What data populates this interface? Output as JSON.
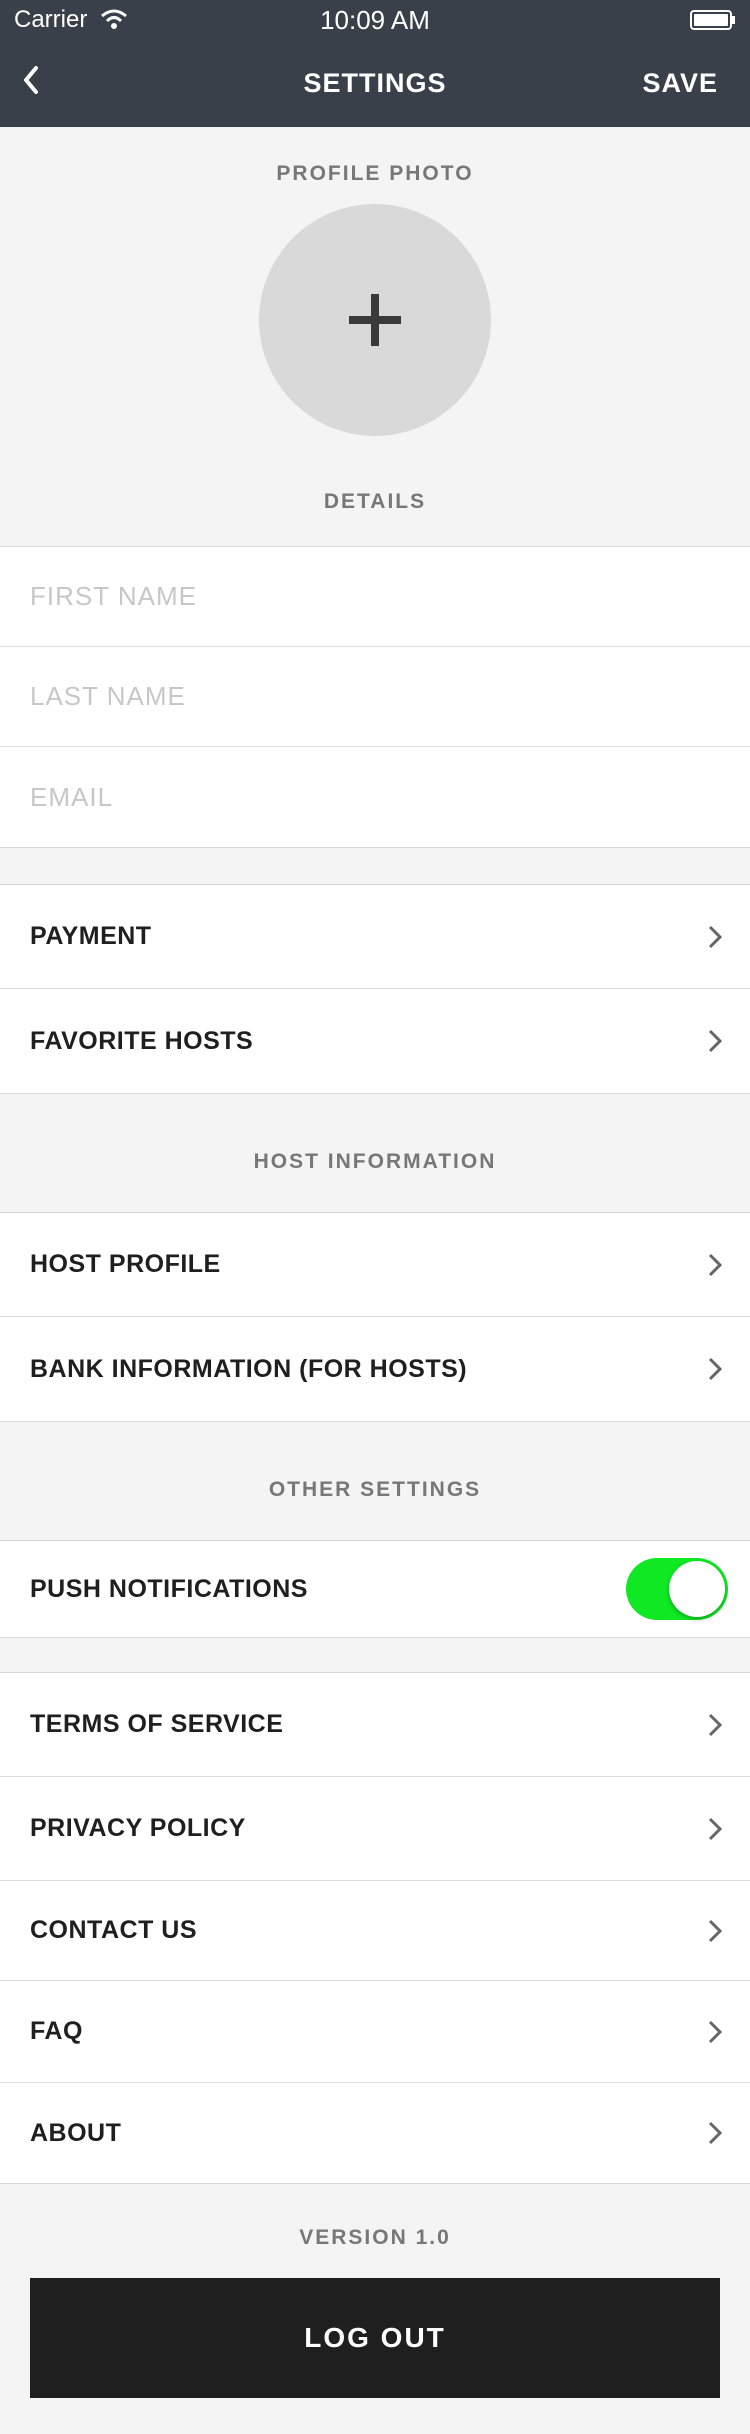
{
  "status_bar": {
    "carrier": "Carrier",
    "time": "10:09 AM"
  },
  "nav": {
    "title": "SETTINGS",
    "save_label": "SAVE"
  },
  "profile": {
    "section_label": "PROFILE PHOTO"
  },
  "details": {
    "section_label": "DETAILS",
    "first_name_placeholder": "FIRST NAME",
    "last_name_placeholder": "LAST NAME",
    "email_placeholder": "EMAIL"
  },
  "account": {
    "payment": "PAYMENT",
    "favorite_hosts": "FAVORITE HOSTS"
  },
  "host": {
    "section_label": "HOST INFORMATION",
    "host_profile": "HOST PROFILE",
    "bank_information": "BANK INFORMATION (FOR HOSTS)"
  },
  "other": {
    "section_label": "OTHER SETTINGS",
    "push_notifications": "PUSH NOTIFICATIONS",
    "push_enabled": true
  },
  "info": {
    "terms": "TERMS OF SERVICE",
    "privacy": "PRIVACY POLICY",
    "contact": "CONTACT US",
    "faq": "FAQ",
    "about": "ABOUT"
  },
  "footer": {
    "version": "VERSION 1.0",
    "logout_label": "LOG OUT"
  },
  "colors": {
    "nav_bg": "#394049",
    "page_bg": "#f4f4f4",
    "toggle_on": "#10e824",
    "logout_bg": "#1f1f1f"
  },
  "icons": [
    "wifi-icon",
    "battery-icon",
    "back-icon",
    "plus-icon",
    "chevron-right-icon"
  ]
}
